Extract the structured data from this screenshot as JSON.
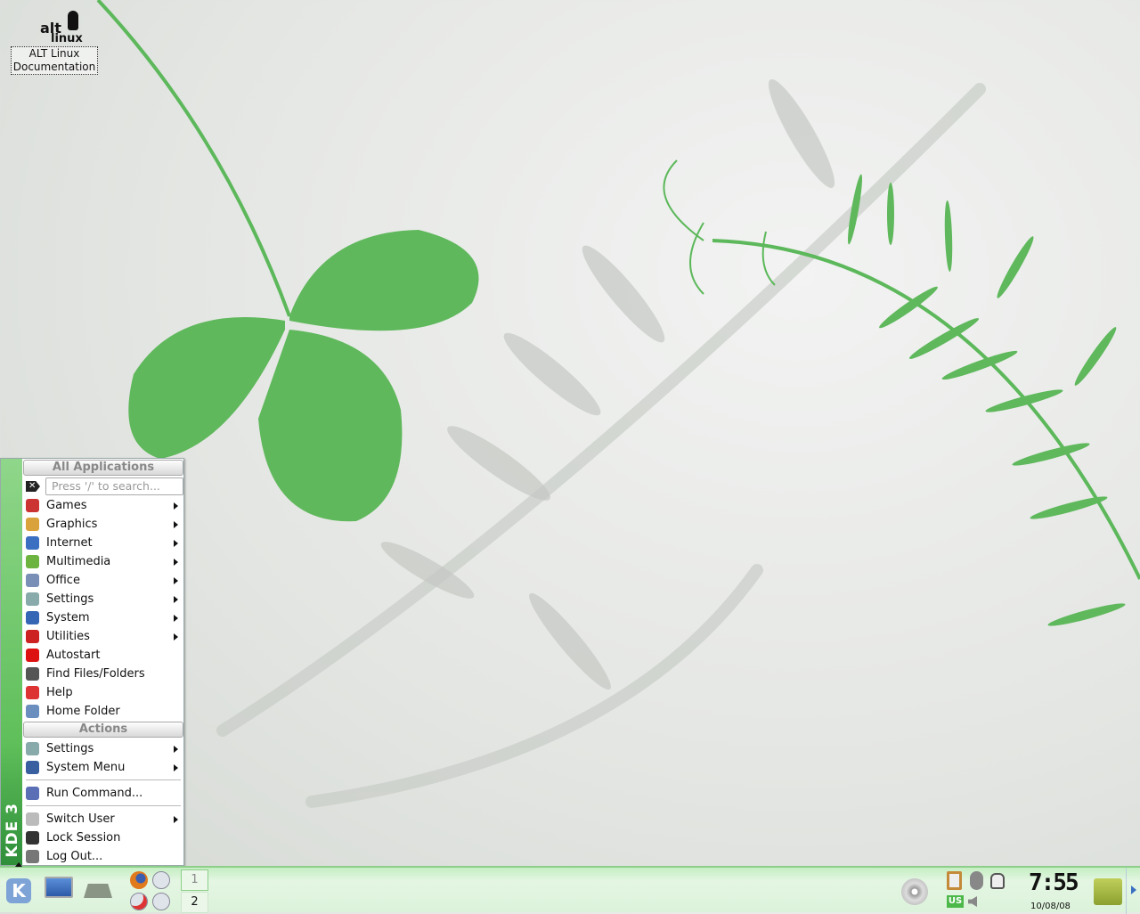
{
  "desktop": {
    "icons": [
      {
        "label_line1": "ALT Linux",
        "label_line2": "Documentation",
        "logo_text": "alt linux"
      }
    ]
  },
  "menu": {
    "side_text": "KDE 3",
    "header_apps": "All Applications",
    "search_placeholder": "Press '/' to search...",
    "apps": [
      {
        "label": "Games",
        "icon": "games-icon",
        "submenu": true,
        "color": "#c33"
      },
      {
        "label": "Graphics",
        "icon": "graphics-icon",
        "submenu": true,
        "color": "#d9a23a"
      },
      {
        "label": "Internet",
        "icon": "internet-icon",
        "submenu": true,
        "color": "#3a6fc2"
      },
      {
        "label": "Multimedia",
        "icon": "multimedia-icon",
        "submenu": true,
        "color": "#6cb33f"
      },
      {
        "label": "Office",
        "icon": "office-icon",
        "submenu": true,
        "color": "#7a8fb5"
      },
      {
        "label": "Settings",
        "icon": "settings-icon",
        "submenu": true,
        "color": "#8aa"
      },
      {
        "label": "System",
        "icon": "system-icon",
        "submenu": true,
        "color": "#3565b5"
      },
      {
        "label": "Utilities",
        "icon": "utilities-icon",
        "submenu": true,
        "color": "#c22"
      },
      {
        "label": "Autostart",
        "icon": "folder-red-icon",
        "submenu": false,
        "color": "#d11"
      },
      {
        "label": "Find Files/Folders",
        "icon": "binoculars-icon",
        "submenu": false,
        "color": "#555"
      },
      {
        "label": "Help",
        "icon": "lifebuoy-icon",
        "submenu": false,
        "color": "#d33"
      },
      {
        "label": "Home Folder",
        "icon": "home-folder-icon",
        "submenu": false,
        "color": "#6a8fbf"
      }
    ],
    "header_actions": "Actions",
    "actions": [
      {
        "label": "Settings",
        "icon": "settings-icon",
        "submenu": true,
        "color": "#8aa"
      },
      {
        "label": "System Menu",
        "icon": "monitor-icon",
        "submenu": true,
        "color": "#3a5fa0"
      },
      {
        "label": "Run Command...",
        "icon": "run-icon",
        "submenu": false,
        "color": "#5a6fb5"
      },
      {
        "label": "Switch User",
        "icon": "switch-user-icon",
        "submenu": true,
        "color": "#bbb"
      },
      {
        "label": "Lock Session",
        "icon": "lock-icon",
        "submenu": false,
        "color": "#333"
      },
      {
        "label": "Log Out...",
        "icon": "logout-icon",
        "submenu": false,
        "color": "#777"
      }
    ]
  },
  "taskbar": {
    "pager": [
      "1",
      "2"
    ],
    "keyboard_layout": "US",
    "clock": "7:55",
    "date": "10/08/08"
  }
}
